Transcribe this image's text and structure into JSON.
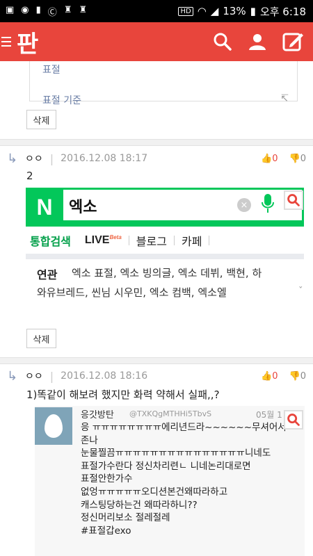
{
  "status_bar": {
    "battery": "13%",
    "time": "오후 6:18",
    "hd": "HD"
  },
  "app_bar": {
    "logo": "판"
  },
  "prev_card": {
    "line1": "표절",
    "line2": "표절 기준",
    "arrow": "↸"
  },
  "delete_label": "삭제",
  "comments": [
    {
      "author": "ㅇㅇ",
      "date": "2016.12.08 18:17",
      "up": "0",
      "down": "0",
      "text": "2"
    },
    {
      "author": "ㅇㅇ",
      "date": "2016.12.08 18:16",
      "up": "0",
      "down": "0",
      "text": "1)똑같이 해보려 했지만 화력 약해서 실패,,?"
    }
  ],
  "naver": {
    "logo": "N",
    "query": "엑소",
    "clear": "×",
    "tabs": [
      "통합검색",
      "LIVE",
      "블로그",
      "카페"
    ],
    "beta": "Beta",
    "related_label": "연관",
    "related_line1": "엑소 표절, 엑소 빙의글, 엑소 데뷔, 백현, 하",
    "related_line2": "와유브레드, 씬님 시우민, 엑소 컴백, 엑소엘",
    "chevron": "ˇ"
  },
  "tweet": {
    "name": "응갓방탄",
    "handle": "@TXKQgMTHHi5TbvS",
    "date": "05월 1",
    "lines": [
      "응 ㅠㅠㅠㅠㅠㅠㅠㅠ에리년드라~~~~~~무셔어서",
      "존나",
      "눈물찔끔ㅠㅠㅠㅠㅠㅠㅠㅠㅠㅠㅠㅠㅠㅠㅠ니네도",
      "표절가수란다 정신차리련ㄴ 니네논리대로면",
      "표절안한가수",
      "없엉ㅠㅠㅠㅠㅠ오디션본건왜따라하고",
      "캐스팅당하는건 왜따라하니??",
      "정신머리보소 절레절레",
      "#표절갑exo"
    ]
  },
  "colors": {
    "brand": "#e8453c",
    "naver_green": "#03c75a",
    "link_blue": "#6a7ea6"
  }
}
